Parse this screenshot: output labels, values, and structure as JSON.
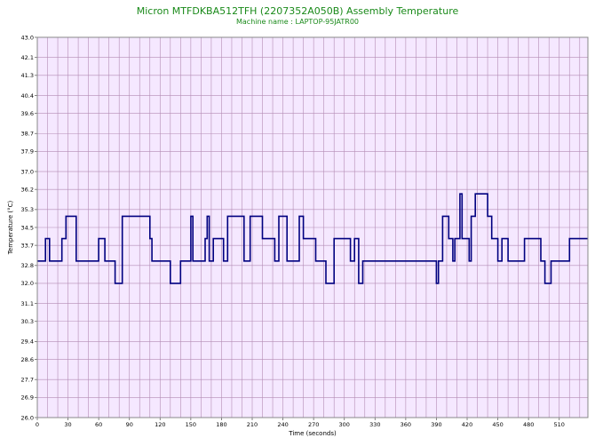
{
  "chart_data": {
    "type": "line",
    "title": "Micron MTFDKBA512TFH (2207352A050B) Assembly Temperature",
    "subtitle": "Machine name : LAPTOP-95JATR00",
    "xlabel": "Time (seconds)",
    "ylabel": "Temperature (°C)",
    "xlim": [
      0,
      538
    ],
    "ylim": [
      26.0,
      43.0
    ],
    "x_ticks": [
      0,
      30,
      60,
      90,
      120,
      150,
      180,
      210,
      240,
      270,
      300,
      330,
      360,
      390,
      420,
      450,
      480,
      510
    ],
    "y_ticks": [
      "26.0",
      "26.9",
      "27.7",
      "28.6",
      "29.4",
      "30.3",
      "31.1",
      "32.0",
      "32.8",
      "33.7",
      "34.5",
      "35.3",
      "36.2",
      "37.0",
      "37.9",
      "38.7",
      "39.6",
      "40.4",
      "41.3",
      "42.1",
      "43.0"
    ],
    "grid": true,
    "legend": "none",
    "colors": {
      "line": "#000080",
      "plot_bg": "#f5e8ff",
      "grid": "#b48cb4",
      "title": "#1a8a1a"
    },
    "series": [
      {
        "step": true,
        "x": [
          0,
          8,
          10,
          12,
          24,
          28,
          38,
          40,
          60,
          62,
          66,
          70,
          72,
          76,
          83,
          94,
          96,
          110,
          112,
          124,
          130,
          140,
          142,
          150,
          152,
          164,
          166,
          168,
          172,
          176,
          182,
          186,
          188,
          202,
          204,
          208,
          212,
          220,
          232,
          234,
          236,
          244,
          254,
          256,
          260,
          272,
          278,
          280,
          282,
          290,
          298,
          306,
          310,
          314,
          318,
          352,
          370,
          386,
          390,
          392,
          396,
          400,
          402,
          406,
          408,
          411,
          413,
          415,
          422,
          424,
          426,
          428,
          432,
          440,
          444,
          450,
          454,
          456,
          460,
          470,
          476,
          480,
          492,
          496,
          498,
          502,
          510,
          514,
          520,
          538
        ],
        "y": [
          33.0,
          34.0,
          34.0,
          33.0,
          34.0,
          35.0,
          33.0,
          33.0,
          34.0,
          34.0,
          33.0,
          33.0,
          33.0,
          32.0,
          35.0,
          35.0,
          35.0,
          34.0,
          33.0,
          33.0,
          32.0,
          33.0,
          33.0,
          35.0,
          33.0,
          34.0,
          35.0,
          33.0,
          34.0,
          34.0,
          33.0,
          35.0,
          35.0,
          33.0,
          33.0,
          35.0,
          35.0,
          34.0,
          33.0,
          33.0,
          35.0,
          33.0,
          33.0,
          35.0,
          34.0,
          33.0,
          33.0,
          33.0,
          32.0,
          34.0,
          34.0,
          33.0,
          34.0,
          32.0,
          33.0,
          33.0,
          33.0,
          33.0,
          32.0,
          33.0,
          35.0,
          35.0,
          34.0,
          33.0,
          34.0,
          34.0,
          36.0,
          34.0,
          33.0,
          35.0,
          35.0,
          36.0,
          36.0,
          35.0,
          34.0,
          33.0,
          34.0,
          34.0,
          33.0,
          33.0,
          34.0,
          34.0,
          33.0,
          32.0,
          32.0,
          33.0,
          33.0,
          33.0,
          34.0,
          34.0
        ]
      }
    ]
  }
}
